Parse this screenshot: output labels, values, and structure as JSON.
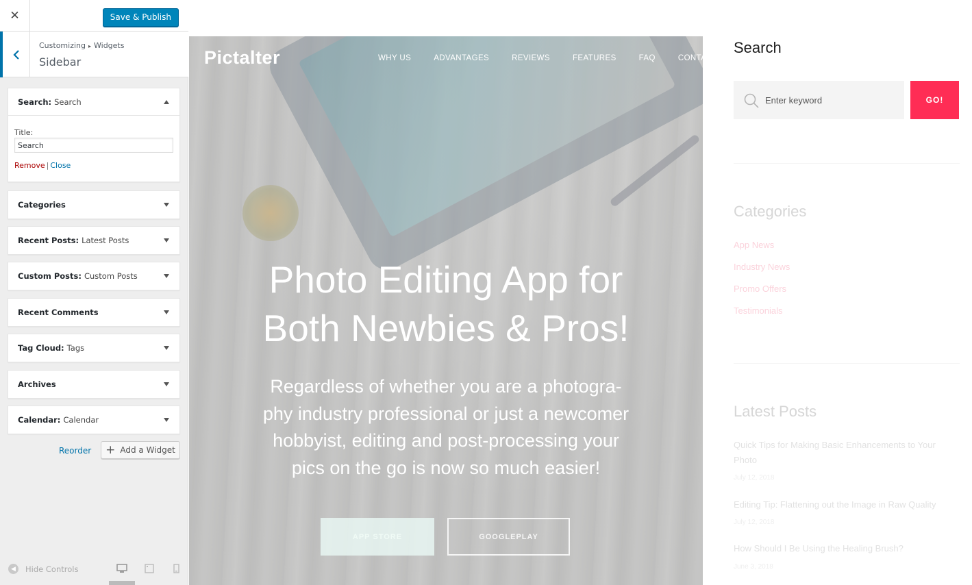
{
  "customizer": {
    "close_icon_char": "✕",
    "publish_label": "Save & Publish",
    "breadcrumb": {
      "root": "Customizing",
      "separator": "▸",
      "current": "Widgets"
    },
    "section_title": "Sidebar",
    "search_widget": {
      "name": "Search:",
      "subtitle": "Search",
      "title_label": "Title:",
      "title_value": "Search",
      "remove_label": "Remove",
      "divider": "|",
      "close_label": "Close"
    },
    "widgets": [
      {
        "name": "Categories",
        "subtitle": ""
      },
      {
        "name": "Recent Posts:",
        "subtitle": "Latest Posts"
      },
      {
        "name": "Custom Posts:",
        "subtitle": "Custom Posts"
      },
      {
        "name": "Recent Comments",
        "subtitle": ""
      },
      {
        "name": "Tag Cloud:",
        "subtitle": "Tags"
      },
      {
        "name": "Archives",
        "subtitle": ""
      },
      {
        "name": "Calendar:",
        "subtitle": "Calendar"
      }
    ],
    "reorder_label": "Reorder",
    "add_widget_label": "Add a Widget",
    "hide_controls_label": "Hide Controls",
    "accent_color": "#0073aa",
    "publish_color": "#0085ba"
  },
  "preview": {
    "brand": "Pictalter",
    "nav": [
      "WHY US",
      "ADVANTAGES",
      "REVIEWS",
      "FEATURES",
      "FAQ",
      "CONTACT"
    ],
    "hero_title_line1": "Photo Editing App for",
    "hero_title_line2": "Both Newbies & Pros!",
    "hero_desc_lines": [
      "Regardless of whether you are a photogra-",
      "phy industry professional or just a newcomer",
      "hobbyist, editing and post-processing your",
      "pics on the go is now so much easier!"
    ],
    "btn_appstore": "APP STORE",
    "btn_googleplay": "GOOGLEPLAY"
  },
  "site_sidebar": {
    "search_title": "Search",
    "search_placeholder": "Enter keyword",
    "go_label": "GO!",
    "go_color": "#ff2d55",
    "categories_title": "Categories",
    "categories": [
      "App News",
      "Industry News",
      "Promo Offers",
      "Testimonials"
    ],
    "latest_title": "Latest Posts",
    "posts": [
      {
        "title": "Quick Tips for Making Basic Enhancements to Your Photo",
        "date": "July 12, 2018"
      },
      {
        "title": "Editing Tip: Flattening out the Image in Raw Quality",
        "date": "July 12, 2018"
      },
      {
        "title": "How Should I Be Using the Healing Brush?",
        "date": "June 3, 2018"
      }
    ]
  }
}
